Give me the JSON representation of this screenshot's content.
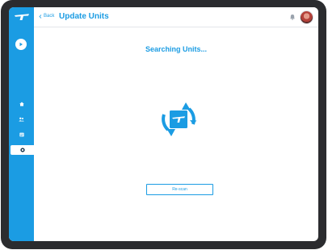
{
  "header": {
    "back_label": "Back",
    "title": "Update Units"
  },
  "main": {
    "status_title": "Searching Units...",
    "rescan_label": "Re-scan"
  },
  "sidebar": {
    "items": [
      {
        "icon": "home-icon"
      },
      {
        "icon": "users-icon"
      },
      {
        "icon": "list-icon"
      },
      {
        "icon": "gear-icon",
        "active": true
      }
    ]
  },
  "colors": {
    "accent": "#1b9ce3",
    "device": "#2b2c2f"
  }
}
